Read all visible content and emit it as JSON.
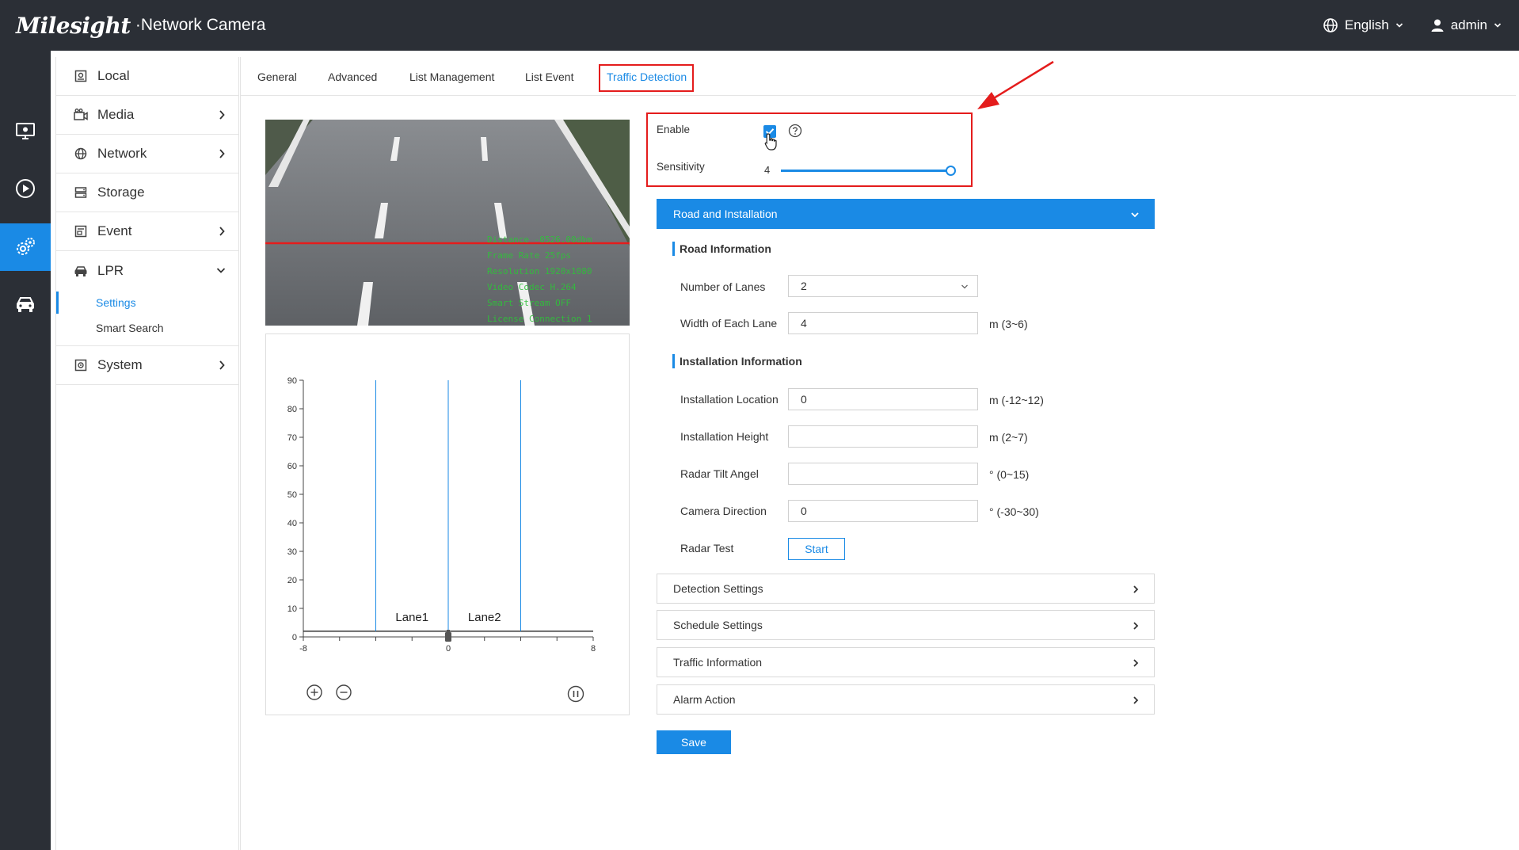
{
  "header": {
    "brand": "Milesight",
    "product": "·Network Camera",
    "language": "English",
    "user": "admin"
  },
  "rail": {
    "items": [
      {
        "icon": "monitor-icon"
      },
      {
        "icon": "playback-icon"
      },
      {
        "icon": "settings-icon"
      },
      {
        "icon": "vehicle-icon"
      }
    ],
    "active_index": 2
  },
  "sidebar": {
    "items": [
      {
        "label": "Local",
        "icon": "local-icon"
      },
      {
        "label": "Media",
        "icon": "media-icon"
      },
      {
        "label": "Network",
        "icon": "network-icon"
      },
      {
        "label": "Storage",
        "icon": "storage-icon"
      },
      {
        "label": "Event",
        "icon": "event-icon"
      },
      {
        "label": "LPR",
        "icon": "lpr-icon"
      },
      {
        "label": "System",
        "icon": "system-icon"
      }
    ],
    "lpr_sub": [
      {
        "label": "Settings",
        "active": true
      },
      {
        "label": "Smart Search",
        "active": false
      }
    ]
  },
  "tabs": [
    {
      "label": "General"
    },
    {
      "label": "Advanced"
    },
    {
      "label": "List Management"
    },
    {
      "label": "List Event"
    },
    {
      "label": "Traffic Detection",
      "active": true
    }
  ],
  "preview": {
    "osd": [
      "Distance  -0526.00dbm",
      "Frame Rate  25fps",
      "Resolution  1920x1080",
      "Video Codec  H.264",
      "Smart Stream  OFF",
      "License Connection  1"
    ]
  },
  "radar_chart": {
    "y_ticks": [
      "90",
      "80",
      "70",
      "60",
      "50",
      "40",
      "30",
      "20",
      "10",
      "0"
    ],
    "x_ticks": [
      "-8",
      "0",
      "8"
    ],
    "lanes": [
      "Lane1",
      "Lane2"
    ],
    "lane_boundaries": [
      -4,
      0,
      4
    ],
    "ymax": 90,
    "xmin": -8,
    "xmax": 8
  },
  "settings": {
    "enable_label": "Enable",
    "enable_checked": true,
    "sensitivity_label": "Sensitivity",
    "sensitivity_value": "4",
    "sensitivity_fraction": 1.0
  },
  "road": {
    "header": "Road and Installation",
    "road_info_title": "Road Information",
    "lanes_label": "Number of Lanes",
    "lanes_value": "2",
    "width_label": "Width of Each Lane",
    "width_value": "4",
    "width_unit": "m (3~6)",
    "install_info_title": "Installation Information",
    "location_label": "Installation Location",
    "location_value": "0",
    "location_unit": "m (-12~12)",
    "height_label": "Installation Height",
    "height_value": "",
    "height_unit": "m (2~7)",
    "tilt_label": "Radar Tilt Angel",
    "tilt_value": "",
    "tilt_unit": "° (0~15)",
    "direction_label": "Camera Direction",
    "direction_value": "0",
    "direction_unit": "° (-30~30)",
    "radar_test_label": "Radar Test",
    "start_label": "Start"
  },
  "accordions": [
    {
      "label": "Detection Settings"
    },
    {
      "label": "Schedule Settings"
    },
    {
      "label": "Traffic Information"
    },
    {
      "label": "Alarm Action"
    }
  ],
  "save_label": "Save",
  "colors": {
    "accent": "#1a8ae5",
    "header_bg": "#2b2f36",
    "annotation": "#e41c1c",
    "osd_text": "#2fc13a"
  }
}
